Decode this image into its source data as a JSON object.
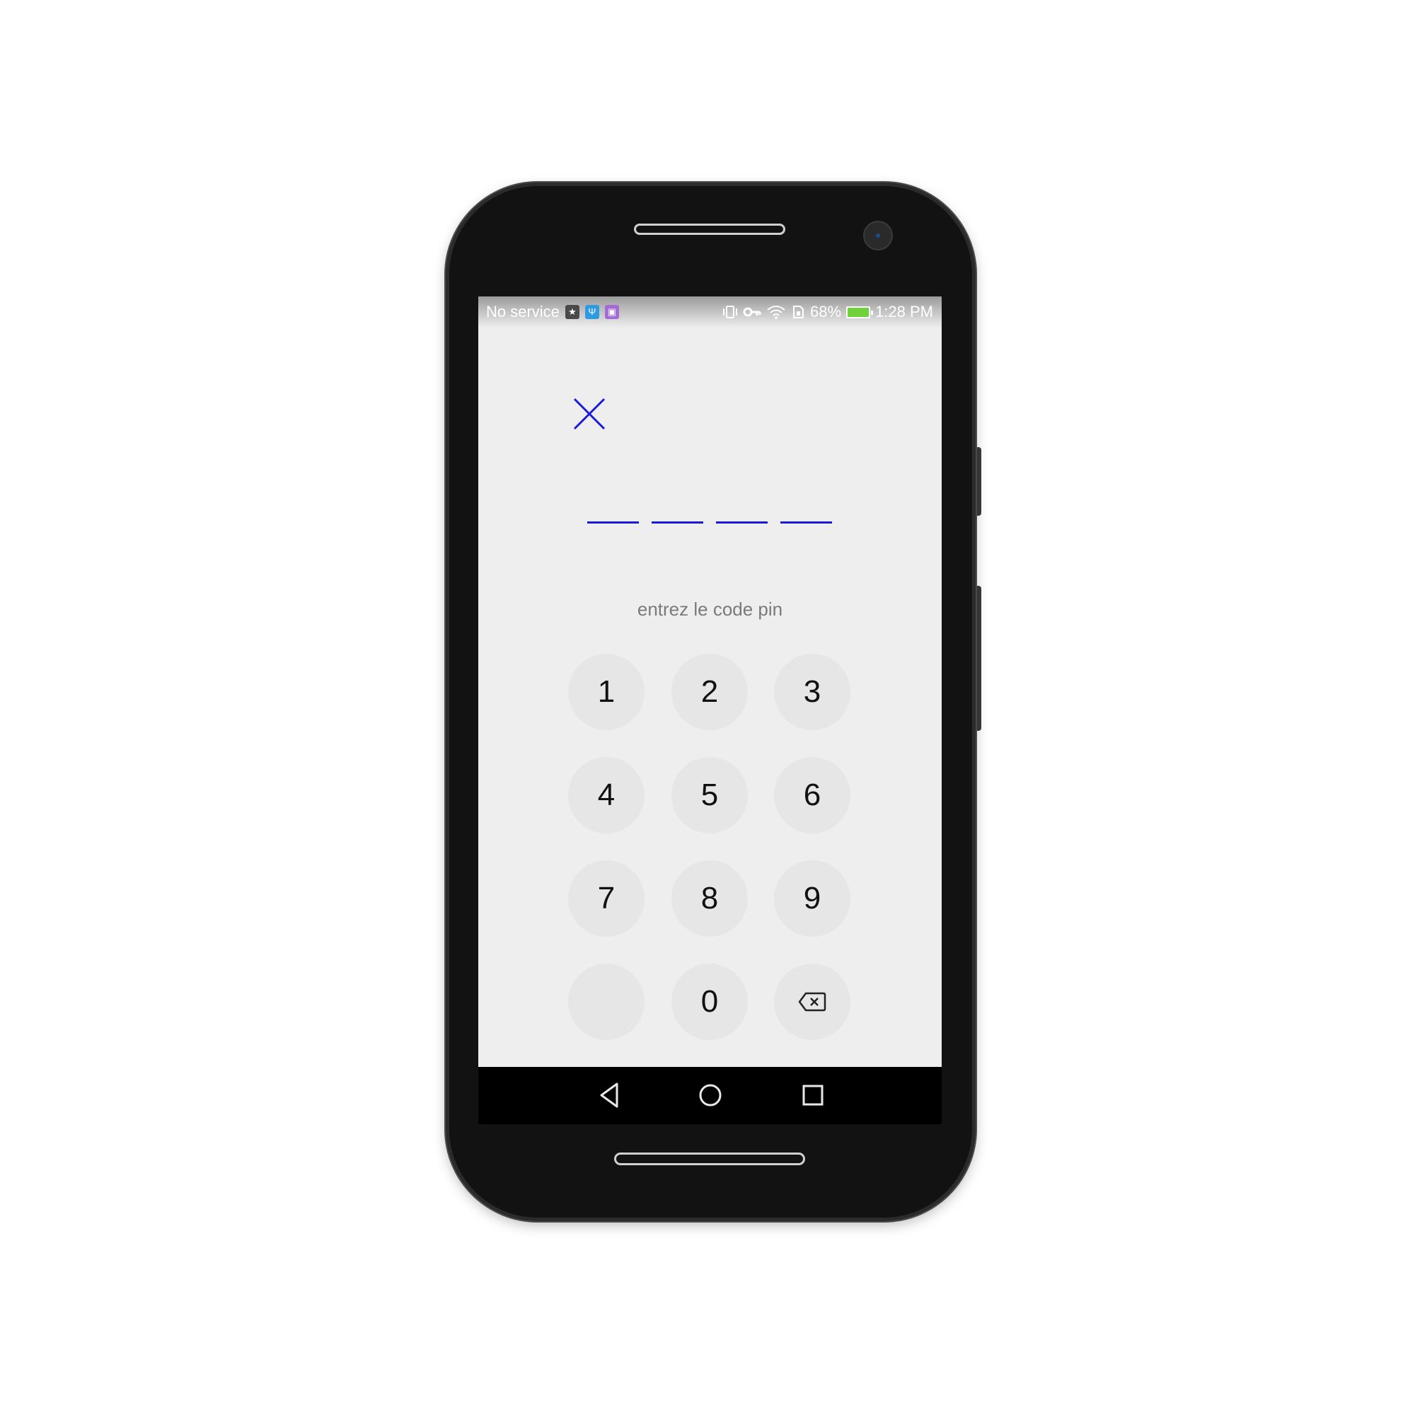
{
  "status_bar": {
    "carrier": "No service",
    "battery_percent": "68%",
    "time": "1:28 PM",
    "left_icons": [
      "accessibility-icon",
      "usb-icon",
      "image-icon"
    ],
    "right_icons": [
      "vibrate-icon",
      "vpn-key-icon",
      "wifi-icon",
      "sim-icon",
      "battery-charging-icon"
    ]
  },
  "pin_screen": {
    "close_icon": "close-icon",
    "accent_color": "#1a1adc",
    "pin_length": 4,
    "prompt": "entrez le code pin"
  },
  "keypad": {
    "keys": [
      "1",
      "2",
      "3",
      "4",
      "5",
      "6",
      "7",
      "8",
      "9",
      "",
      "0"
    ],
    "backspace_icon": "backspace-icon"
  },
  "nav_bar": {
    "icons": [
      "back-icon",
      "home-icon",
      "recents-icon"
    ]
  }
}
